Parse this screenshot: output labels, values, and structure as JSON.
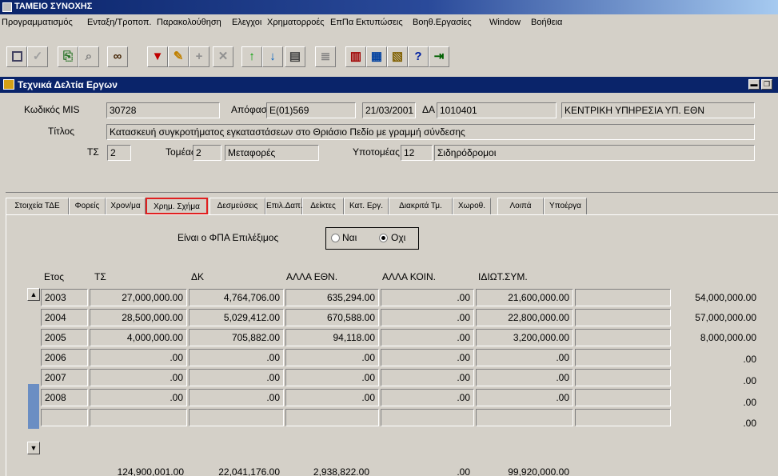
{
  "app": {
    "title": "ΤΑΜΕΙΟ ΣΥΝΟΧΗΣ"
  },
  "menu": [
    "Προγραμματισμός",
    "Ενταξη/Τροποπ.",
    "Παρακολούθηση",
    "Ελεγχοι",
    "Χρηματορροές",
    "ΕπΠα",
    "Εκτυπώσεις",
    "Βοηθ.Εργασίες",
    "Window",
    "Βοήθεια"
  ],
  "toolbar": {
    "buttons": [
      "save-icon",
      "check-icon",
      "copy-icon",
      "search-icon",
      "binoculars-icon",
      "filter-icon",
      "edit-icon",
      "insert-row-icon",
      "delete-row-icon",
      "arrow-up-icon",
      "arrow-down-icon",
      "print-icon",
      "list-icon",
      "notes-icon",
      "report-icon",
      "clipboard-icon",
      "help-icon",
      "exit-icon"
    ],
    "help_glyph": "?"
  },
  "window": {
    "title": "Τεχνικά Δελτία Εργων",
    "min_glyph": "▬",
    "max_glyph": "❐"
  },
  "form": {
    "mis_label": "Κωδικός MIS",
    "mis_value": "30728",
    "decision_label": "Απόφαση",
    "decision_value": "E(01)569",
    "decision_date": "21/03/2001",
    "da_label": "ΔΑ",
    "da_code": "1010401",
    "da_name": "ΚΕΝΤΡΙΚΗ ΥΠΗΡΕΣΙΑ ΥΠ. ΕΘΝ",
    "title_label": "Τίτλος",
    "title_value": "Κατασκευή συγκροτήματος εγκαταστάσεων στο Θριάσιο Πεδίο με γραμμή σύνδεσης",
    "ts_label": "ΤΣ",
    "ts_value": "2",
    "sector_label": "Τομέας",
    "sector_code": "2",
    "sector_name": "Μεταφορές",
    "subsector_label": "Υποτομέας",
    "subsector_code": "12",
    "subsector_name": "Σιδηρόδρομοι"
  },
  "tabs": [
    "Στοιχεία ΤΔΕ",
    "Φορείς",
    "Χρον/μα",
    "Χρημ. Σχήμα",
    "Δεσμεύσεις",
    "Επιλ.Δαπ.",
    "Δείκτες",
    "Κατ. Εργ.",
    "Διακριτά Τμ.",
    "Χωροθ.",
    "Λοιπά",
    "Υποέργα"
  ],
  "active_tab": "Χρημ. Σχήμα",
  "vat": {
    "label": "Είναι ο ΦΠΑ Επιλέξιμος",
    "yes": "Ναι",
    "no": "Οχι",
    "selected": "Οχι"
  },
  "table": {
    "headers": [
      "Ετος",
      "ΤΣ",
      "ΔΚ",
      "ΑΛΛΑ ΕΘΝ.",
      "ΑΛΛΑ ΚΟΙΝ.",
      "ΙΔΙΩΤ.ΣΥΜ."
    ],
    "rows": [
      {
        "year": "2003",
        "ts": "27,000,000.00",
        "dk": "4,764,706.00",
        "alla_ethn": "635,294.00",
        "alla_koin": ".00",
        "idiot": "21,600,000.00",
        "total": "54,000,000.00"
      },
      {
        "year": "2004",
        "ts": "28,500,000.00",
        "dk": "5,029,412.00",
        "alla_ethn": "670,588.00",
        "alla_koin": ".00",
        "idiot": "22,800,000.00",
        "total": "57,000,000.00"
      },
      {
        "year": "2005",
        "ts": "4,000,000.00",
        "dk": "705,882.00",
        "alla_ethn": "94,118.00",
        "alla_koin": ".00",
        "idiot": "3,200,000.00",
        "total": "8,000,000.00"
      },
      {
        "year": "2006",
        "ts": ".00",
        "dk": ".00",
        "alla_ethn": ".00",
        "alla_koin": ".00",
        "idiot": ".00",
        "total": ".00"
      },
      {
        "year": "2007",
        "ts": ".00",
        "dk": ".00",
        "alla_ethn": ".00",
        "alla_koin": ".00",
        "idiot": ".00",
        "total": ".00"
      },
      {
        "year": "2008",
        "ts": ".00",
        "dk": ".00",
        "alla_ethn": ".00",
        "alla_koin": ".00",
        "idiot": ".00",
        "total": ".00"
      },
      {
        "year": "",
        "ts": "",
        "dk": "",
        "alla_ethn": "",
        "alla_koin": "",
        "idiot": "",
        "total": ".00"
      }
    ],
    "totals": {
      "ts": "124,900,001.00",
      "dk": "22,041,176.00",
      "alla_ethn": "2,938,822.00",
      "alla_koin": ".00",
      "idiot": "99,920,000.00"
    }
  },
  "colors": {
    "face": "#d4d0c8",
    "titlebar": "#0a246a",
    "active_tab_border": "#e02020",
    "scroll_thumb": "#6b8ec3"
  }
}
